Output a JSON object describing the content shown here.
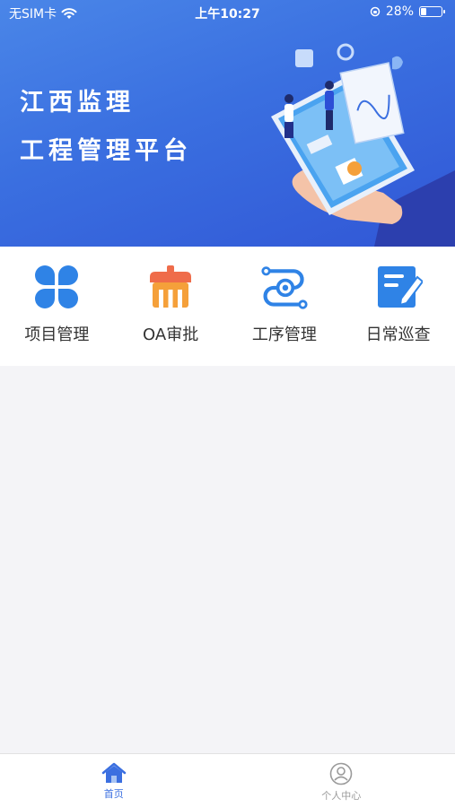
{
  "status_bar": {
    "carrier": "无SIM卡",
    "time": "上午10:27",
    "battery": "28%",
    "battery_level": 0.28
  },
  "banner": {
    "line1": "江西监理",
    "line2": "工程管理平台"
  },
  "menu": {
    "items": [
      {
        "label": "项目管理",
        "icon": "clover-grid-icon"
      },
      {
        "label": "OA审批",
        "icon": "storefront-icon"
      },
      {
        "label": "工序管理",
        "icon": "process-gear-icon"
      },
      {
        "label": "日常巡查",
        "icon": "note-edit-icon"
      }
    ]
  },
  "tabbar": {
    "tabs": [
      {
        "label": "首页",
        "icon": "home-icon",
        "active": true
      },
      {
        "label": "个人中心",
        "icon": "user-circle-icon",
        "active": false
      }
    ]
  },
  "colors": {
    "accent": "#3b6fe0",
    "icon_blue": "#2f83e6",
    "icon_orange": "#f5a03a",
    "icon_red": "#ef6c4a"
  }
}
